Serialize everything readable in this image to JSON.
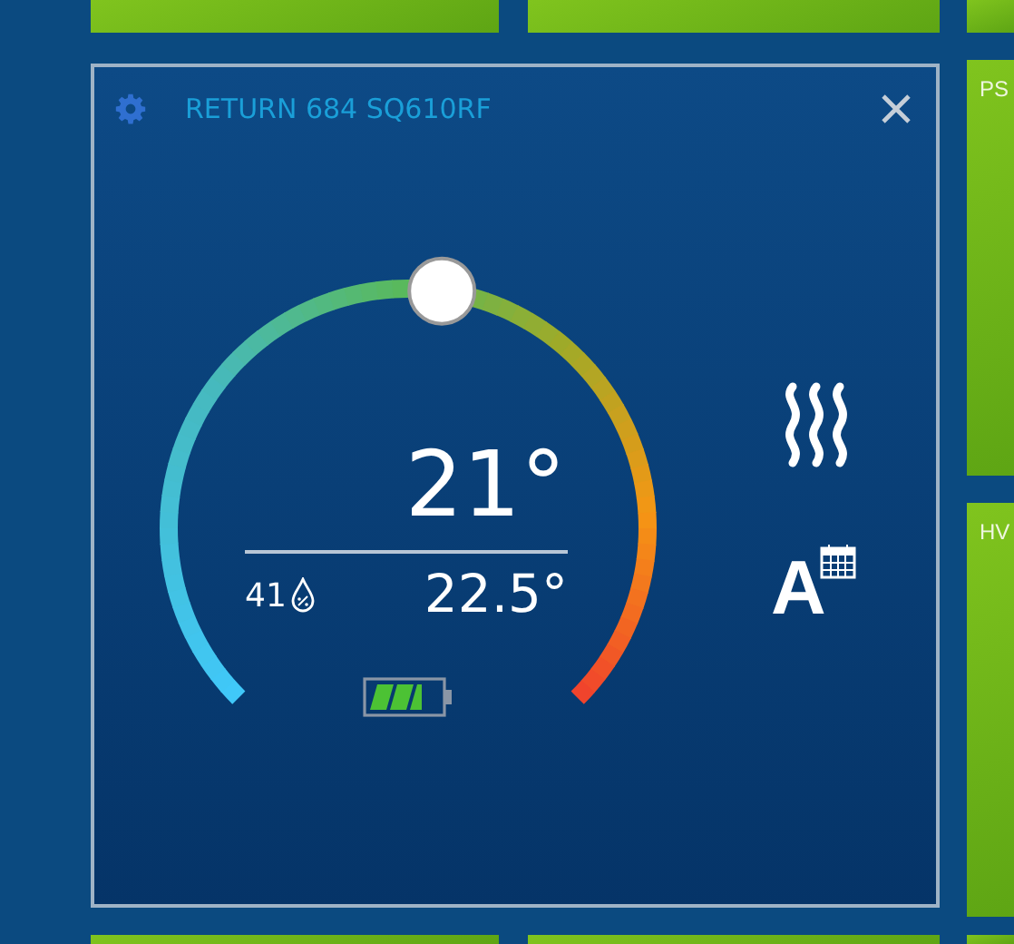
{
  "tiles": [
    {
      "label": "PS"
    },
    {
      "label": "HV"
    }
  ],
  "thermostat": {
    "title": "RETURN 684 SQ610RF",
    "setpoint": "21°",
    "humidity": "41",
    "current_temperature": "22.5°",
    "heating": {
      "on": true
    },
    "mode": {
      "label": "A"
    }
  }
}
